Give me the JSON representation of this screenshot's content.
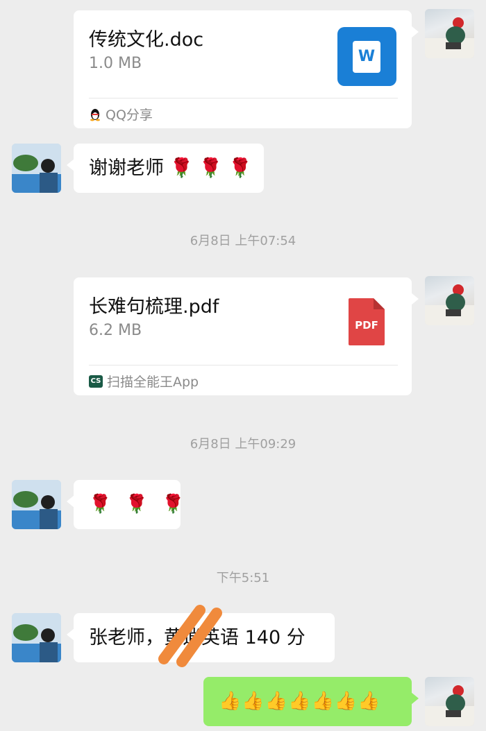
{
  "messages": [
    {
      "type": "file",
      "side": "right",
      "name": "传统文化.doc",
      "size": "1.0 MB",
      "source": "QQ分享",
      "icon": "word-file-icon",
      "icon_letter": "W",
      "icon_color": "#1a7fd6"
    },
    {
      "type": "text",
      "side": "left",
      "text": "谢谢老师 🌹 🌹 🌹"
    },
    {
      "type": "time",
      "text": "6月8日 上午07:54"
    },
    {
      "type": "file",
      "side": "right",
      "name": "长难句梳理.pdf",
      "size": "6.2 MB",
      "source": "扫描全能王App",
      "icon": "pdf-file-icon",
      "icon_text": "PDF",
      "icon_color": "#e04545"
    },
    {
      "type": "time",
      "text": "6月8日 上午09:29"
    },
    {
      "type": "text",
      "side": "left",
      "text": "🌹 🌹 🌹"
    },
    {
      "type": "time",
      "text": "下午5:51"
    },
    {
      "type": "text",
      "side": "left",
      "text_parts": [
        "张老师，",
        "黄逍",
        "英语 140 分"
      ],
      "redaction_color": "#f08a3c"
    },
    {
      "type": "text",
      "side": "right",
      "text": "👍👍👍👍👍👍👍",
      "bubble_color": "#95ec69"
    }
  ]
}
